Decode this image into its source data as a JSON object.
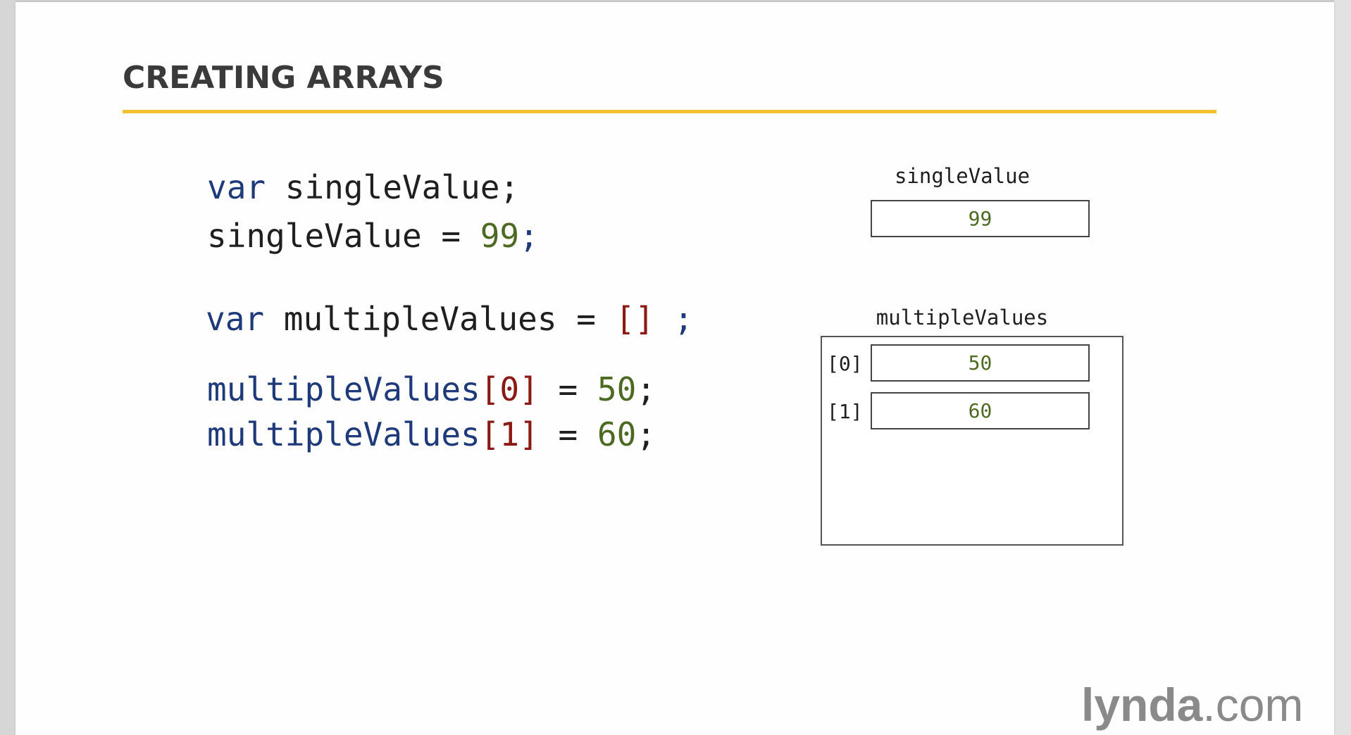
{
  "slide": {
    "title": "CREATING ARRAYS"
  },
  "code": {
    "line1": {
      "kw": "var",
      "rest": " singleValue;"
    },
    "line2": {
      "ident": "singleValue = ",
      "num": "99",
      "semi": ";"
    },
    "line3": {
      "kw": "var",
      "ident": " multipleValues = ",
      "brackets": "[]",
      "semi": " ;"
    },
    "line4": {
      "ident": "multipleValues",
      "index": "[0]",
      "eq": " = ",
      "num": "50",
      "semi": ";"
    },
    "line5": {
      "ident": "multipleValues",
      "index": "[1]",
      "eq": " = ",
      "num": "60",
      "semi": ";"
    }
  },
  "diagram": {
    "single_label": "singleValue",
    "single_value": "99",
    "array_label": "multipleValues",
    "items": [
      {
        "index": "[0]",
        "value": "50"
      },
      {
        "index": "[1]",
        "value": "60"
      }
    ]
  },
  "branding": {
    "logo_bold": "lynda",
    "logo_rest": ".com"
  },
  "colors": {
    "accent_rule": "#f2c12e",
    "keyword": "#1e3a7a",
    "number": "#4d6a22",
    "bracket": "#8b1a14"
  }
}
